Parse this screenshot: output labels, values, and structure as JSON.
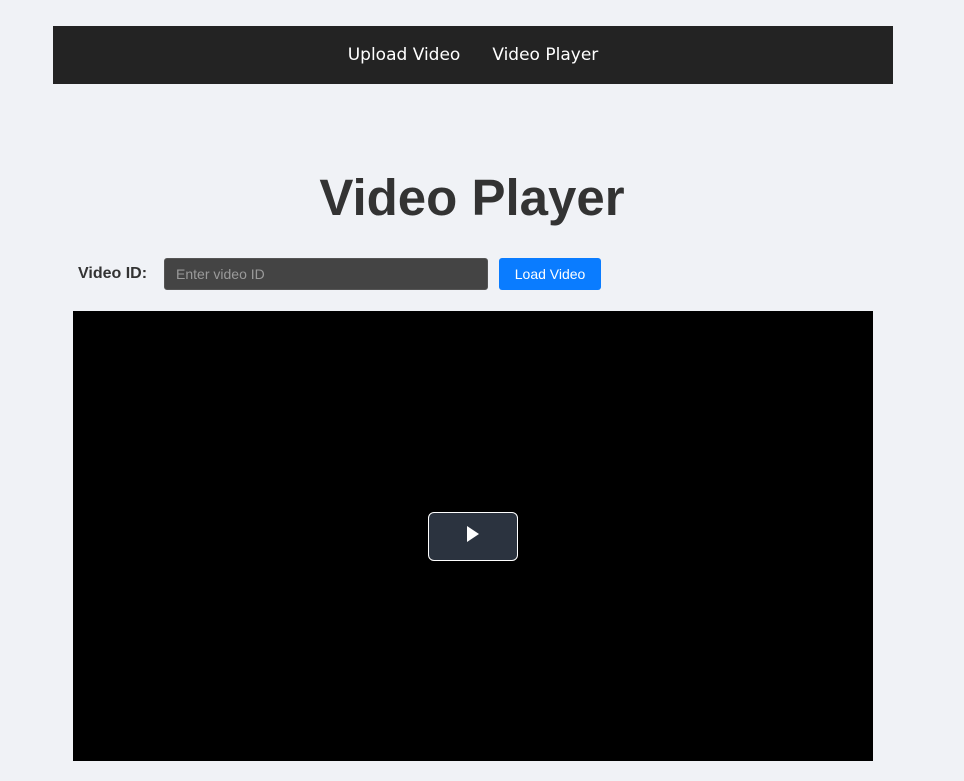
{
  "nav": {
    "links": [
      {
        "label": "Upload Video"
      },
      {
        "label": "Video Player"
      }
    ]
  },
  "page": {
    "title": "Video Player"
  },
  "form": {
    "video_id_label": "Video ID:",
    "video_id_value": "",
    "video_id_placeholder": "Enter video ID",
    "load_button_label": "Load Video"
  },
  "player": {
    "play_icon": "play-icon"
  },
  "colors": {
    "background": "#f0f2f6",
    "navbar": "#232323",
    "accent": "#0a7cff",
    "input_bg": "#444444",
    "video_bg": "#000000"
  }
}
